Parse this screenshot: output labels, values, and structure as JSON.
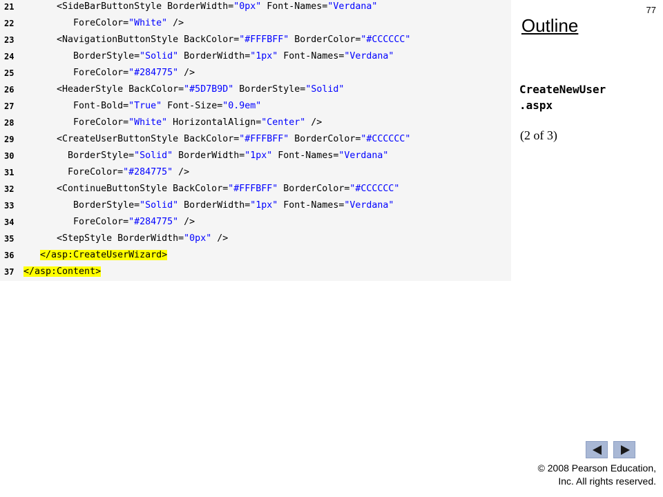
{
  "slide": {
    "number": "77",
    "outline_title": "Outline",
    "file_name": "CreateNewUser\n.aspx",
    "page_info": "(2 of 3)",
    "copyright_line1": "© 2008 Pearson Education,",
    "copyright_line2": "Inc.  All rights reserved."
  },
  "code_lines": [
    {
      "num": "21",
      "segments": [
        [
          "t",
          "      <SideBarButtonStyle BorderWidth="
        ],
        [
          "v",
          "\"0px\""
        ],
        [
          "t",
          " Font-Names="
        ],
        [
          "v",
          "\"Verdana\""
        ]
      ]
    },
    {
      "num": "22",
      "segments": [
        [
          "t",
          "         ForeColor="
        ],
        [
          "v",
          "\"White\""
        ],
        [
          "t",
          " />"
        ]
      ]
    },
    {
      "num": "23",
      "segments": [
        [
          "t",
          "      <NavigationButtonStyle BackColor="
        ],
        [
          "v",
          "\"#FFFBFF\""
        ],
        [
          "t",
          " BorderColor="
        ],
        [
          "v",
          "\"#CCCCCC\""
        ]
      ]
    },
    {
      "num": "24",
      "segments": [
        [
          "t",
          "         BorderStyle="
        ],
        [
          "v",
          "\"Solid\""
        ],
        [
          "t",
          " BorderWidth="
        ],
        [
          "v",
          "\"1px\""
        ],
        [
          "t",
          " Font-Names="
        ],
        [
          "v",
          "\"Verdana\""
        ]
      ]
    },
    {
      "num": "25",
      "segments": [
        [
          "t",
          "         ForeColor="
        ],
        [
          "v",
          "\"#284775\""
        ],
        [
          "t",
          " />"
        ]
      ]
    },
    {
      "num": "26",
      "segments": [
        [
          "t",
          "      <HeaderStyle BackColor="
        ],
        [
          "v",
          "\"#5D7B9D\""
        ],
        [
          "t",
          " BorderStyle="
        ],
        [
          "v",
          "\"Solid\""
        ]
      ]
    },
    {
      "num": "27",
      "segments": [
        [
          "t",
          "         Font-Bold="
        ],
        [
          "v",
          "\"True\""
        ],
        [
          "t",
          " Font-Size="
        ],
        [
          "v",
          "\"0.9em\""
        ]
      ]
    },
    {
      "num": "28",
      "segments": [
        [
          "t",
          "         ForeColor="
        ],
        [
          "v",
          "\"White\""
        ],
        [
          "t",
          " HorizontalAlign="
        ],
        [
          "v",
          "\"Center\""
        ],
        [
          "t",
          " />"
        ]
      ]
    },
    {
      "num": "29",
      "segments": [
        [
          "t",
          "      <CreateUserButtonStyle BackColor="
        ],
        [
          "v",
          "\"#FFFBFF\""
        ],
        [
          "t",
          " BorderColor="
        ],
        [
          "v",
          "\"#CCCCCC\""
        ]
      ]
    },
    {
      "num": "30",
      "segments": [
        [
          "t",
          "        BorderStyle="
        ],
        [
          "v",
          "\"Solid\""
        ],
        [
          "t",
          " BorderWidth="
        ],
        [
          "v",
          "\"1px\""
        ],
        [
          "t",
          " Font-Names="
        ],
        [
          "v",
          "\"Verdana\""
        ]
      ]
    },
    {
      "num": "31",
      "segments": [
        [
          "t",
          "        ForeColor="
        ],
        [
          "v",
          "\"#284775\""
        ],
        [
          "t",
          " />"
        ]
      ]
    },
    {
      "num": "32",
      "segments": [
        [
          "t",
          "      <ContinueButtonStyle BackColor="
        ],
        [
          "v",
          "\"#FFFBFF\""
        ],
        [
          "t",
          " BorderColor="
        ],
        [
          "v",
          "\"#CCCCCC\""
        ]
      ]
    },
    {
      "num": "33",
      "segments": [
        [
          "t",
          "         BorderStyle="
        ],
        [
          "v",
          "\"Solid\""
        ],
        [
          "t",
          " BorderWidth="
        ],
        [
          "v",
          "\"1px\""
        ],
        [
          "t",
          " Font-Names="
        ],
        [
          "v",
          "\"Verdana\""
        ]
      ]
    },
    {
      "num": "34",
      "segments": [
        [
          "t",
          "         ForeColor="
        ],
        [
          "v",
          "\"#284775\""
        ],
        [
          "t",
          " />"
        ]
      ]
    },
    {
      "num": "35",
      "segments": [
        [
          "t",
          "      <StepStyle BorderWidth="
        ],
        [
          "v",
          "\"0px\""
        ],
        [
          "t",
          " />"
        ]
      ]
    },
    {
      "num": "36",
      "segments": [
        [
          "t",
          "   "
        ],
        [
          "h",
          "</asp:CreateUserWizard>"
        ]
      ]
    },
    {
      "num": "37",
      "segments": [
        [
          "h",
          "</asp:Content>"
        ]
      ]
    }
  ],
  "colors": {
    "code_background": "#f5f5f5",
    "value_color": "#0000ff",
    "highlight": "#ffff00",
    "nav_button": "#a9b8d5"
  },
  "navigation": {
    "prev_icon": "triangle-left-icon",
    "next_icon": "triangle-right-icon"
  }
}
